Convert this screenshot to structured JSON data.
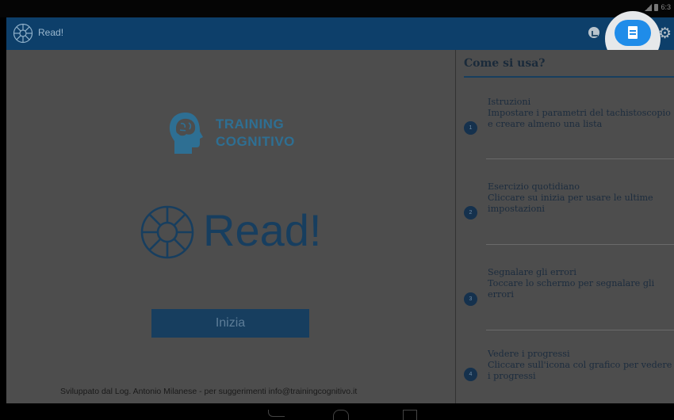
{
  "status_bar": {
    "time": "6:3"
  },
  "app_bar": {
    "title": "Read!"
  },
  "main": {
    "brand_line1": "TRAINING",
    "brand_line2": "COGNITIVO",
    "app_name": "Read!",
    "start_label": "Inizia",
    "footer": "Sviluppato dal Log. Antonio Milanese - per suggerimenti info@trainingcognitivo.it"
  },
  "help": {
    "title": "Come si usa?",
    "steps": [
      {
        "num": "1",
        "title": "Istruzioni",
        "text": "Impostare i parametri del tachistoscopio e creare almeno una lista"
      },
      {
        "num": "2",
        "title": "Esercizio quotidiano",
        "text": "Cliccare su inizia per usare le ultime impostazioni"
      },
      {
        "num": "3",
        "title": "Segnalare gli errori",
        "text": "Toccare lo schermo per segnalare gli errori"
      },
      {
        "num": "4",
        "title": "Vedere i progressi",
        "text": "Cliccare sull'icona col grafico per vedere i progressi"
      }
    ]
  },
  "icons": {
    "app_logo": "wheel-logo-icon",
    "chart": "chart-icon",
    "list": "list-icon",
    "settings": "gear-icon",
    "back": "back-icon",
    "home": "home-icon",
    "recents": "recents-icon"
  },
  "colors": {
    "app_bar": "#0d3f6a",
    "highlight_button": "#1f8ce9",
    "dim_overlay": "#4d4d4d",
    "brand": "#2e6f93"
  }
}
